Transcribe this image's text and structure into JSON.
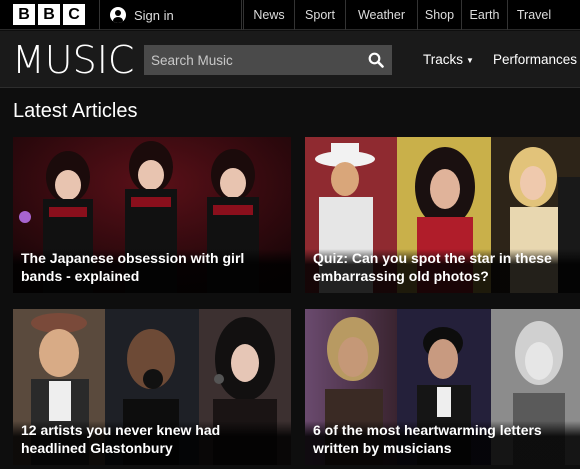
{
  "topbar": {
    "logo_letters": [
      "B",
      "B",
      "C"
    ],
    "signin_label": "Sign in",
    "nav": [
      "News",
      "Sport",
      "Weather",
      "Shop",
      "Earth",
      "Travel"
    ]
  },
  "header": {
    "title": "MUSIC",
    "search_placeholder": "Search Music",
    "nav_tracks": "Tracks",
    "nav_performances": "Performances"
  },
  "section": {
    "title": "Latest Articles"
  },
  "articles": [
    {
      "title": "The Japanese obsession with girl bands - explained"
    },
    {
      "title": "Quiz: Can you spot the star in these embarrassing old photos?"
    },
    {
      "title": "12 artists you never knew had headlined Glastonbury"
    },
    {
      "title": "6 of the most heartwarming letters written by musicians"
    }
  ],
  "colors": {
    "page_bg": "#0e0e0e",
    "header_bg": "#1a1a1a",
    "search_bg": "#4a4a4a"
  }
}
